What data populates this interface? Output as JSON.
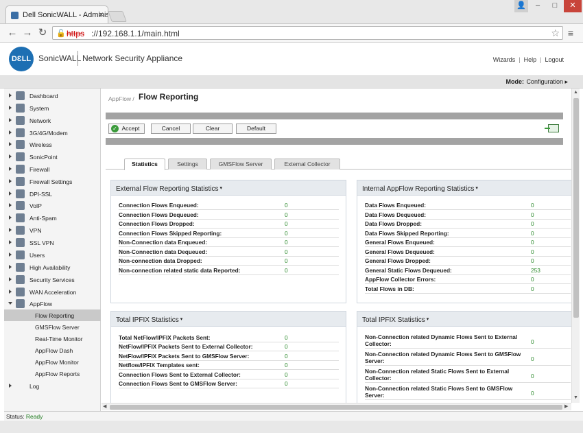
{
  "browser": {
    "tab_title": "Dell SonicWALL - Adminis",
    "url_scheme": "https",
    "url_rest": "://192.168.1.1/main.html"
  },
  "header": {
    "brand": "SonicWALL",
    "logo_text": "DƐLL",
    "product": "Network Security Appliance",
    "links": [
      "Wizards",
      "Help",
      "Logout"
    ],
    "mode_label": "Mode:",
    "mode_value": "Configuration ▸"
  },
  "sidebar": {
    "items": [
      {
        "label": "Dashboard",
        "icon": "dashboard-icon"
      },
      {
        "label": "System",
        "icon": "system-icon"
      },
      {
        "label": "Network",
        "icon": "network-icon"
      },
      {
        "label": "3G/4G/Modem",
        "icon": "modem-icon"
      },
      {
        "label": "Wireless",
        "icon": "wireless-icon"
      },
      {
        "label": "SonicPoint",
        "icon": "sonicpoint-icon"
      },
      {
        "label": "Firewall",
        "icon": "firewall-icon"
      },
      {
        "label": "Firewall Settings",
        "icon": "firewall-settings-icon"
      },
      {
        "label": "DPI-SSL",
        "icon": "dpi-ssl-icon"
      },
      {
        "label": "VoIP",
        "icon": "voip-icon"
      },
      {
        "label": "Anti-Spam",
        "icon": "anti-spam-icon"
      },
      {
        "label": "VPN",
        "icon": "vpn-icon"
      },
      {
        "label": "SSL VPN",
        "icon": "ssl-vpn-icon"
      },
      {
        "label": "Users",
        "icon": "users-icon"
      },
      {
        "label": "High Availability",
        "icon": "high-availability-icon"
      },
      {
        "label": "Security Services",
        "icon": "security-services-icon"
      },
      {
        "label": "WAN Acceleration",
        "icon": "wan-acceleration-icon"
      },
      {
        "label": "AppFlow",
        "icon": "appflow-icon"
      }
    ],
    "appflow_children": [
      "Flow Reporting",
      "GMSFlow Server",
      "Real-Time Monitor",
      "AppFlow Dash",
      "AppFlow Monitor",
      "AppFlow Reports"
    ],
    "log_label": "Log"
  },
  "main": {
    "breadcrumb": "AppFlow /",
    "title": "Flow Reporting",
    "buttons": {
      "accept": "Accept",
      "cancel": "Cancel",
      "clear": "Clear",
      "default": "Default"
    },
    "tabs": [
      "Statistics",
      "Settings",
      "GMSFlow Server",
      "External Collector"
    ],
    "panels": {
      "external_flow": {
        "title": "External Flow Reporting Statistics",
        "rows": [
          {
            "label": "Connection Flows Enqueued:",
            "value": "0"
          },
          {
            "label": "Connection Flows Dequeued:",
            "value": "0"
          },
          {
            "label": "Connection Flows Dropped:",
            "value": "0"
          },
          {
            "label": "Connection Flows Skipped Reporting:",
            "value": "0"
          },
          {
            "label": "Non-Connection data Enqueued:",
            "value": "0"
          },
          {
            "label": "Non-Connection data Dequeued:",
            "value": "0"
          },
          {
            "label": "Non-connection data Dropped:",
            "value": "0"
          },
          {
            "label": "Non-connection related static data Reported:",
            "value": "0"
          }
        ]
      },
      "internal_appflow": {
        "title": "Internal AppFlow Reporting Statistics",
        "rows": [
          {
            "label": "Data Flows Enqueued:",
            "value": "0"
          },
          {
            "label": "Data Flows Dequeued:",
            "value": "0"
          },
          {
            "label": "Data Flows Dropped:",
            "value": "0"
          },
          {
            "label": "Data Flows Skipped Reporting:",
            "value": "0"
          },
          {
            "label": "General Flows Enqueued:",
            "value": "0"
          },
          {
            "label": "General Flows Dequeued:",
            "value": "0"
          },
          {
            "label": "General Flows Dropped:",
            "value": "0"
          },
          {
            "label": "General Static Flows Dequeued:",
            "value": "253"
          },
          {
            "label": "AppFlow Collector Errors:",
            "value": "0"
          },
          {
            "label": "Total Flows in DB:",
            "value": "0"
          }
        ]
      },
      "ipfix_left": {
        "title": "Total IPFIX Statistics",
        "rows": [
          {
            "label": "Total NetFlow/IPFIX Packets Sent:",
            "value": "0"
          },
          {
            "label": "NetFlow/IPFIX Packets Sent to External Collector:",
            "value": "0"
          },
          {
            "label": "NetFlow/IPFIX Packets Sent to GMSFlow Server:",
            "value": "0"
          },
          {
            "label": "Netflow/IPFIX Templates sent:",
            "value": "0"
          },
          {
            "label": "Connection Flows Sent to External Collector:",
            "value": "0"
          },
          {
            "label": "Connection Flows Sent to GMSFlow Server:",
            "value": "0"
          }
        ]
      },
      "ipfix_right": {
        "title": "Total IPFIX Statistics",
        "rows": [
          {
            "label": "Non-Connection related Dynamic Flows Sent to External Collector:",
            "value": "0"
          },
          {
            "label": "Non-Connection related Dynamic Flows Sent to GMSFlow Server:",
            "value": "0"
          },
          {
            "label": "Non-Connection related Static Flows Sent to External Collector:",
            "value": "0"
          },
          {
            "label": "Non-Connection related Static Flows Sent to GMSFlow Server:",
            "value": "0"
          }
        ]
      }
    }
  },
  "status": {
    "label": "Status:",
    "value": "Ready"
  },
  "colors": {
    "accent": "#1d6fb3",
    "value_green": "#2c8a2c",
    "panel_head": "#e7ebef"
  }
}
